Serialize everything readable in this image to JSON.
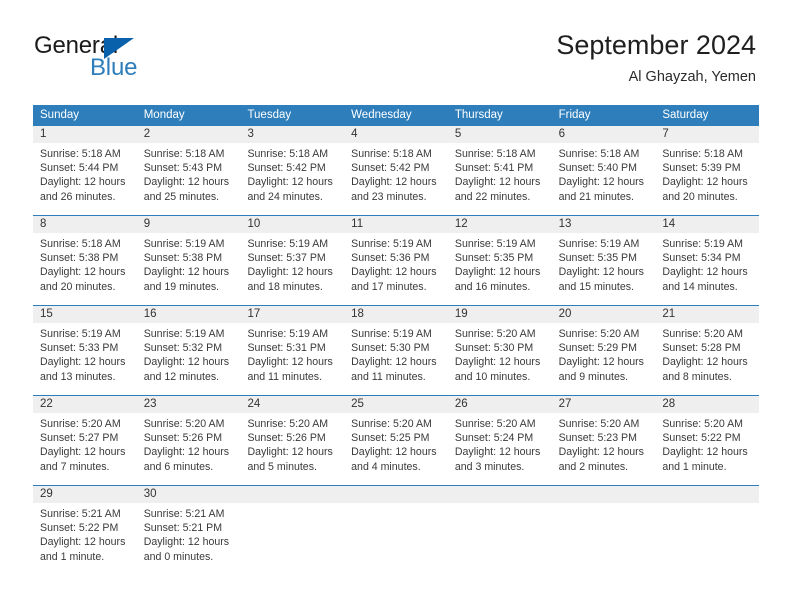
{
  "brand": {
    "general": "General",
    "blue": "Blue",
    "triangle_color": "#0a61ab",
    "blue_color": "#2e7ebb"
  },
  "header": {
    "title": "September 2024",
    "subtitle": "Al Ghayzah, Yemen"
  },
  "theme": {
    "header_blue": "#2e7ebb",
    "day_band_gray": "#efefef",
    "text": "#3a3a3a"
  },
  "weekday_headers": [
    "Sunday",
    "Monday",
    "Tuesday",
    "Wednesday",
    "Thursday",
    "Friday",
    "Saturday"
  ],
  "weeks": [
    [
      {
        "day": "1",
        "lines": [
          "Sunrise: 5:18 AM",
          "Sunset: 5:44 PM",
          "Daylight: 12 hours",
          "and 26 minutes."
        ]
      },
      {
        "day": "2",
        "lines": [
          "Sunrise: 5:18 AM",
          "Sunset: 5:43 PM",
          "Daylight: 12 hours",
          "and 25 minutes."
        ]
      },
      {
        "day": "3",
        "lines": [
          "Sunrise: 5:18 AM",
          "Sunset: 5:42 PM",
          "Daylight: 12 hours",
          "and 24 minutes."
        ]
      },
      {
        "day": "4",
        "lines": [
          "Sunrise: 5:18 AM",
          "Sunset: 5:42 PM",
          "Daylight: 12 hours",
          "and 23 minutes."
        ]
      },
      {
        "day": "5",
        "lines": [
          "Sunrise: 5:18 AM",
          "Sunset: 5:41 PM",
          "Daylight: 12 hours",
          "and 22 minutes."
        ]
      },
      {
        "day": "6",
        "lines": [
          "Sunrise: 5:18 AM",
          "Sunset: 5:40 PM",
          "Daylight: 12 hours",
          "and 21 minutes."
        ]
      },
      {
        "day": "7",
        "lines": [
          "Sunrise: 5:18 AM",
          "Sunset: 5:39 PM",
          "Daylight: 12 hours",
          "and 20 minutes."
        ]
      }
    ],
    [
      {
        "day": "8",
        "lines": [
          "Sunrise: 5:18 AM",
          "Sunset: 5:38 PM",
          "Daylight: 12 hours",
          "and 20 minutes."
        ]
      },
      {
        "day": "9",
        "lines": [
          "Sunrise: 5:19 AM",
          "Sunset: 5:38 PM",
          "Daylight: 12 hours",
          "and 19 minutes."
        ]
      },
      {
        "day": "10",
        "lines": [
          "Sunrise: 5:19 AM",
          "Sunset: 5:37 PM",
          "Daylight: 12 hours",
          "and 18 minutes."
        ]
      },
      {
        "day": "11",
        "lines": [
          "Sunrise: 5:19 AM",
          "Sunset: 5:36 PM",
          "Daylight: 12 hours",
          "and 17 minutes."
        ]
      },
      {
        "day": "12",
        "lines": [
          "Sunrise: 5:19 AM",
          "Sunset: 5:35 PM",
          "Daylight: 12 hours",
          "and 16 minutes."
        ]
      },
      {
        "day": "13",
        "lines": [
          "Sunrise: 5:19 AM",
          "Sunset: 5:35 PM",
          "Daylight: 12 hours",
          "and 15 minutes."
        ]
      },
      {
        "day": "14",
        "lines": [
          "Sunrise: 5:19 AM",
          "Sunset: 5:34 PM",
          "Daylight: 12 hours",
          "and 14 minutes."
        ]
      }
    ],
    [
      {
        "day": "15",
        "lines": [
          "Sunrise: 5:19 AM",
          "Sunset: 5:33 PM",
          "Daylight: 12 hours",
          "and 13 minutes."
        ]
      },
      {
        "day": "16",
        "lines": [
          "Sunrise: 5:19 AM",
          "Sunset: 5:32 PM",
          "Daylight: 12 hours",
          "and 12 minutes."
        ]
      },
      {
        "day": "17",
        "lines": [
          "Sunrise: 5:19 AM",
          "Sunset: 5:31 PM",
          "Daylight: 12 hours",
          "and 11 minutes."
        ]
      },
      {
        "day": "18",
        "lines": [
          "Sunrise: 5:19 AM",
          "Sunset: 5:30 PM",
          "Daylight: 12 hours",
          "and 11 minutes."
        ]
      },
      {
        "day": "19",
        "lines": [
          "Sunrise: 5:20 AM",
          "Sunset: 5:30 PM",
          "Daylight: 12 hours",
          "and 10 minutes."
        ]
      },
      {
        "day": "20",
        "lines": [
          "Sunrise: 5:20 AM",
          "Sunset: 5:29 PM",
          "Daylight: 12 hours",
          "and 9 minutes."
        ]
      },
      {
        "day": "21",
        "lines": [
          "Sunrise: 5:20 AM",
          "Sunset: 5:28 PM",
          "Daylight: 12 hours",
          "and 8 minutes."
        ]
      }
    ],
    [
      {
        "day": "22",
        "lines": [
          "Sunrise: 5:20 AM",
          "Sunset: 5:27 PM",
          "Daylight: 12 hours",
          "and 7 minutes."
        ]
      },
      {
        "day": "23",
        "lines": [
          "Sunrise: 5:20 AM",
          "Sunset: 5:26 PM",
          "Daylight: 12 hours",
          "and 6 minutes."
        ]
      },
      {
        "day": "24",
        "lines": [
          "Sunrise: 5:20 AM",
          "Sunset: 5:26 PM",
          "Daylight: 12 hours",
          "and 5 minutes."
        ]
      },
      {
        "day": "25",
        "lines": [
          "Sunrise: 5:20 AM",
          "Sunset: 5:25 PM",
          "Daylight: 12 hours",
          "and 4 minutes."
        ]
      },
      {
        "day": "26",
        "lines": [
          "Sunrise: 5:20 AM",
          "Sunset: 5:24 PM",
          "Daylight: 12 hours",
          "and 3 minutes."
        ]
      },
      {
        "day": "27",
        "lines": [
          "Sunrise: 5:20 AM",
          "Sunset: 5:23 PM",
          "Daylight: 12 hours",
          "and 2 minutes."
        ]
      },
      {
        "day": "28",
        "lines": [
          "Sunrise: 5:20 AM",
          "Sunset: 5:22 PM",
          "Daylight: 12 hours",
          "and 1 minute."
        ]
      }
    ],
    [
      {
        "day": "29",
        "lines": [
          "Sunrise: 5:21 AM",
          "Sunset: 5:22 PM",
          "Daylight: 12 hours",
          "and 1 minute."
        ]
      },
      {
        "day": "30",
        "lines": [
          "Sunrise: 5:21 AM",
          "Sunset: 5:21 PM",
          "Daylight: 12 hours",
          "and 0 minutes."
        ]
      },
      {
        "day": "",
        "lines": []
      },
      {
        "day": "",
        "lines": []
      },
      {
        "day": "",
        "lines": []
      },
      {
        "day": "",
        "lines": []
      },
      {
        "day": "",
        "lines": []
      }
    ]
  ]
}
